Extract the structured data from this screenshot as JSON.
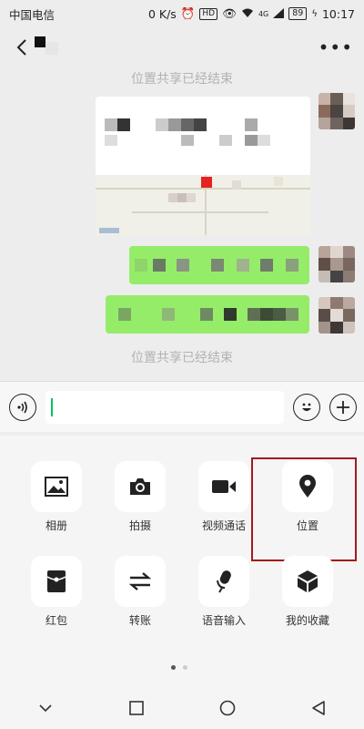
{
  "status_bar": {
    "carrier": "中国电信",
    "speed": "0 K/s",
    "hd": "HD",
    "network": "4G",
    "battery": "89",
    "time": "10:17"
  },
  "chat": {
    "system_messages": [
      "位置共享已经结束",
      "位置共享已经结束"
    ]
  },
  "input_bar": {
    "voice_icon": "voice-icon",
    "emoji_icon": "emoji-icon",
    "plus_icon": "plus-icon"
  },
  "panel": {
    "items": [
      {
        "label": "相册",
        "icon": "image-icon"
      },
      {
        "label": "拍摄",
        "icon": "camera-icon"
      },
      {
        "label": "视频通话",
        "icon": "video-icon"
      },
      {
        "label": "位置",
        "icon": "location-pin-icon"
      },
      {
        "label": "红包",
        "icon": "red-packet-icon"
      },
      {
        "label": "转账",
        "icon": "transfer-icon"
      },
      {
        "label": "语音输入",
        "icon": "microphone-icon"
      },
      {
        "label": "我的收藏",
        "icon": "favorites-icon"
      }
    ],
    "page_indicator": {
      "pages": 2,
      "active": 1
    }
  },
  "colors": {
    "accent_green": "#95ec69",
    "highlight_box": "#a4191c",
    "cursor": "#07c160"
  }
}
